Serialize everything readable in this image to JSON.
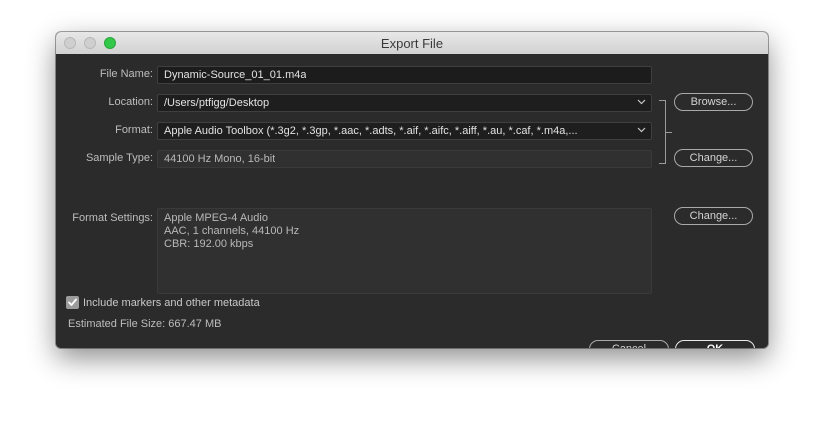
{
  "window": {
    "title": "Export File"
  },
  "form": {
    "file_name_label": "File Name:",
    "file_name_value": "Dynamic-Source_01_01.m4a",
    "location_label": "Location:",
    "location_value": "/Users/ptfigg/Desktop",
    "format_label": "Format:",
    "format_value": "Apple Audio Toolbox (*.3g2, *.3gp, *.aac, *.adts, *.aif, *.aifc, *.aiff, *.au, *.caf, *.m4a,...",
    "sample_type_label": "Sample Type:",
    "sample_type_value": "44100 Hz Mono, 16-bit",
    "format_settings_label": "Format Settings:",
    "format_settings_lines": [
      "Apple MPEG-4 Audio",
      "AAC, 1 channels, 44100 Hz",
      "CBR: 192.00 kbps"
    ]
  },
  "buttons": {
    "browse": "Browse...",
    "change_sample": "Change...",
    "change_format": "Change...",
    "cancel": "Cancel",
    "ok": "OK"
  },
  "metadata": {
    "include_label": "Include markers and other metadata",
    "checked": true
  },
  "estimate": {
    "text": "Estimated File Size: 667.47 MB"
  },
  "icons": {
    "dropdown": "chevron-down-icon",
    "check": "checkmark-icon"
  },
  "colors": {
    "window_bg": "#2b2b2b",
    "zoom_button": "#34c84a"
  }
}
